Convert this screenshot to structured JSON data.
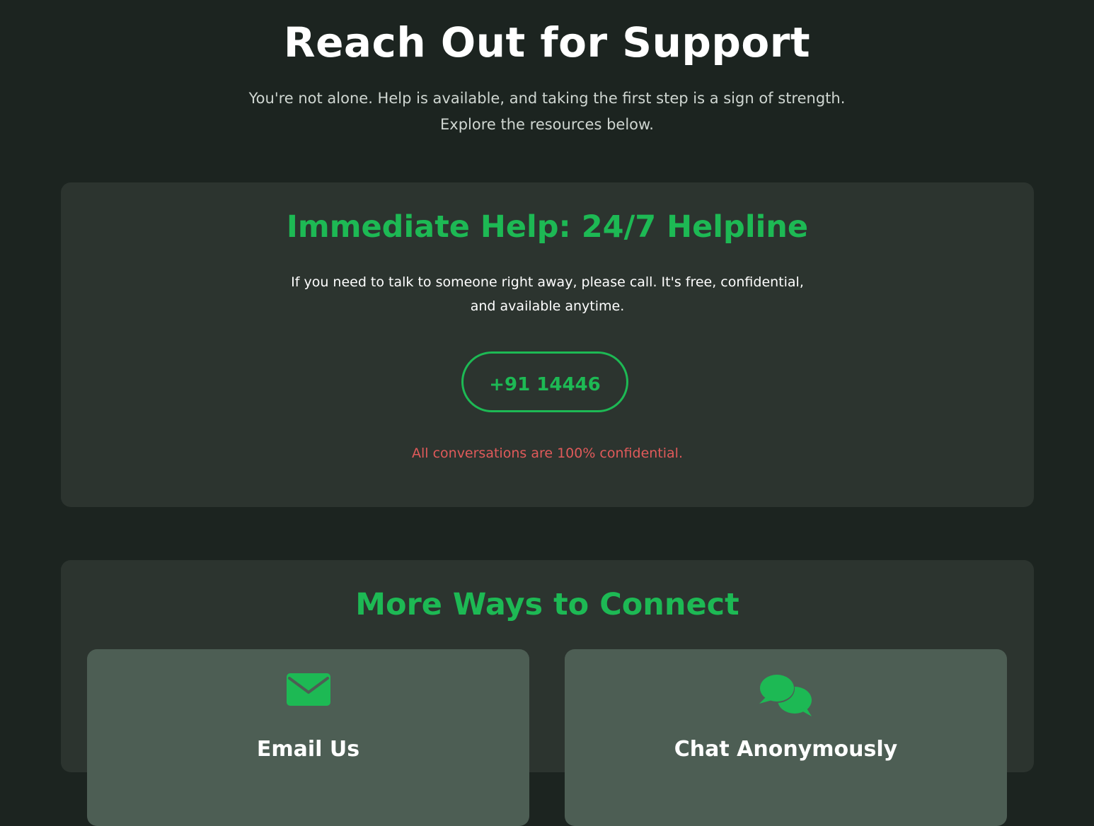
{
  "header": {
    "title": "Reach Out for Support",
    "intro_line1": "You're not alone. Help is available, and taking the first step is a sign of strength.",
    "intro_line2": "Explore the resources below."
  },
  "helpline": {
    "title": "Immediate Help: 24/7 Helpline",
    "text_line1": "If you need to talk to someone right away, please call. It's free, confidential,",
    "text_line2": "and available anytime.",
    "phone": "+91 14446",
    "note": "All conversations are 100% confidential."
  },
  "connect": {
    "title": "More Ways to Connect",
    "options": [
      {
        "label": "Email Us",
        "icon": "envelope-icon"
      },
      {
        "label": "Chat Anonymously",
        "icon": "chat-bubbles-icon"
      }
    ]
  },
  "colors": {
    "background": "#1c2420",
    "card": "#2c342f",
    "option_card": "#4d5e54",
    "accent": "#1db954",
    "note": "#e05a5a"
  }
}
